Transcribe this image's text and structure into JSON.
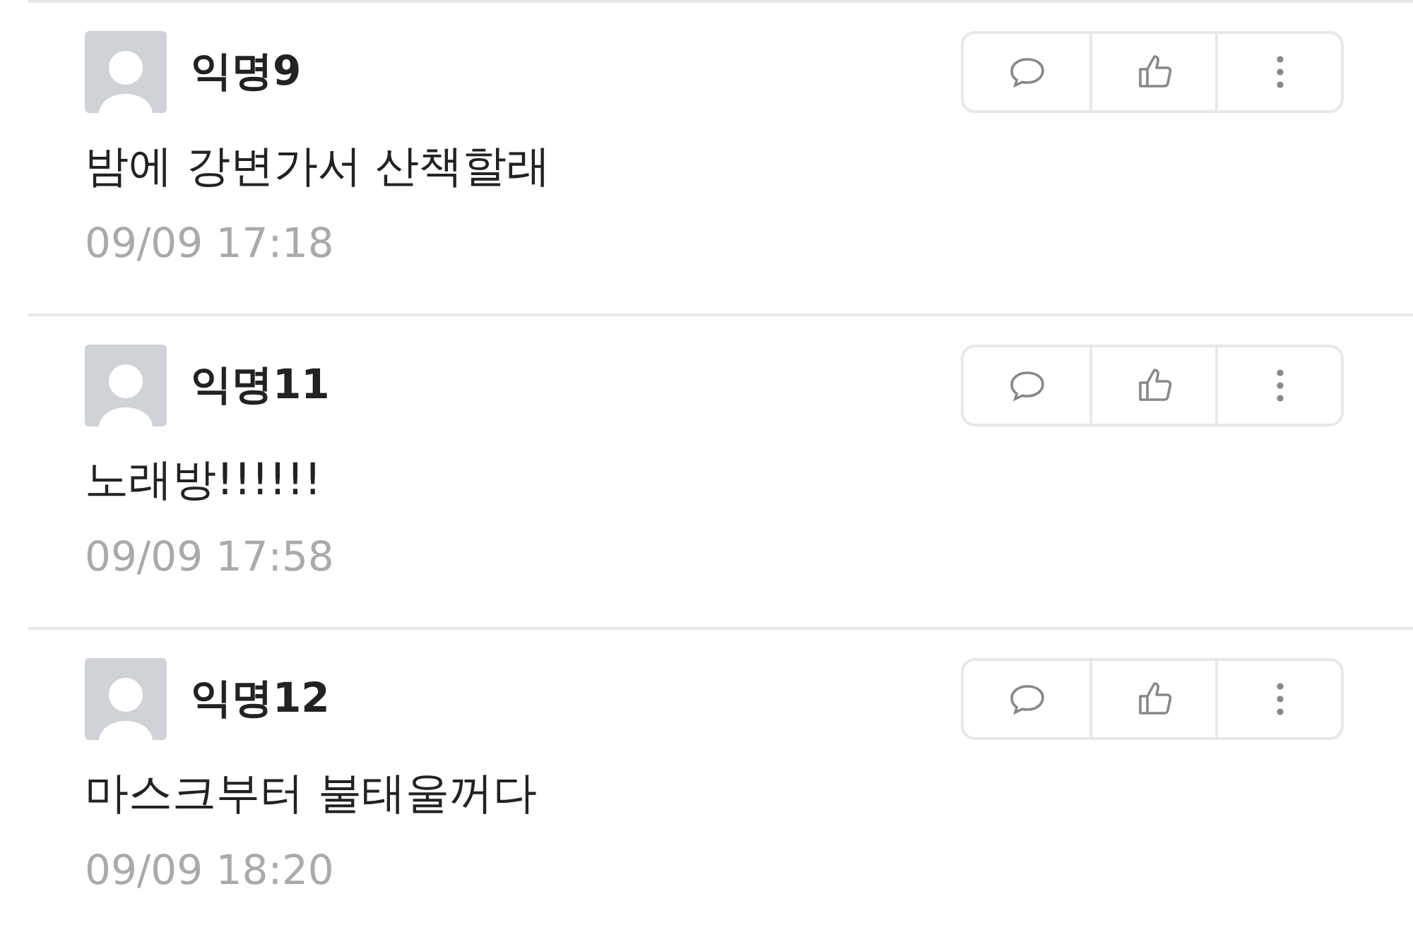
{
  "comments": [
    {
      "author": "익명9",
      "text": "밤에 강변가서 산책할래",
      "time": "09/09 17:18"
    },
    {
      "author": "익명11",
      "text": "노래방!!!!!!",
      "time": "09/09 17:58"
    },
    {
      "author": "익명12",
      "text": "마스크부터 불태울꺼다",
      "time": "09/09 18:20"
    }
  ]
}
